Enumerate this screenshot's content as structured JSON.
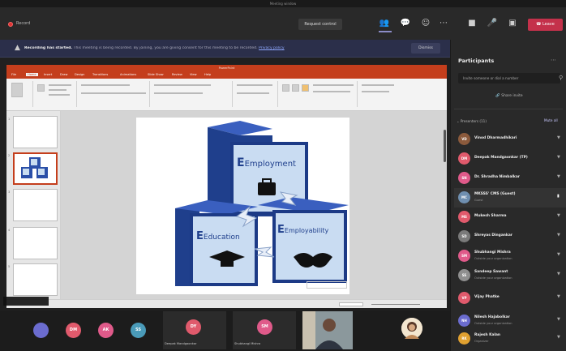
{
  "window": {
    "title": "Meeting window"
  },
  "toolbar": {
    "record_label": "Record",
    "request_control": "Request control",
    "leave_label": "Leave",
    "icons": [
      "people-icon",
      "chat-icon",
      "reactions-icon",
      "more-icon",
      "camera-icon",
      "mic-icon",
      "share-icon"
    ]
  },
  "banner": {
    "bold": "Recording has started.",
    "text": "This meeting is being recorded. By joining, you are giving consent for this meeting to be recorded.",
    "link": "Privacy policy",
    "dismiss": "Dismiss"
  },
  "ppt": {
    "title": "PowerPoint",
    "tabs": [
      "File",
      "Home",
      "Insert",
      "Draw",
      "Design",
      "Transitions",
      "Animations",
      "Slide Show",
      "Review",
      "View",
      "Help"
    ],
    "thumb_numbers": [
      "1",
      "2",
      "3",
      "4",
      "5"
    ]
  },
  "slide": {
    "blocks": {
      "top": "Employment",
      "left": "Education",
      "right": "Employability"
    },
    "caption": "",
    "footer_box": ""
  },
  "presenter_tag": "",
  "strip": {
    "avatars": [
      {
        "initials": "",
        "color": "#6b6ccf"
      },
      {
        "initials": "DM",
        "color": "#e05a6c"
      },
      {
        "initials": "AK",
        "color": "#e05a8a"
      },
      {
        "initials": "SS",
        "color": "#4a9bb9"
      }
    ],
    "tiles": [
      {
        "initials": "DY",
        "color": "#e05a6c",
        "label": "Deepak Mandgaonkar"
      },
      {
        "initials": "SM",
        "color": "#e05a8a",
        "label": "Shubhangi Mishra"
      }
    ]
  },
  "participants": {
    "title": "Participants",
    "search_placeholder": "Invite someone or dial a number",
    "share_invite": "Share invite",
    "section": "Presenters (11)",
    "mute_all": "Mute all",
    "list": [
      {
        "name": "Vinod Dharmadhikari",
        "sub": "",
        "initials": "VD",
        "color": "#8b5a3c"
      },
      {
        "name": "Deepak Mandgaonkar (TP)",
        "sub": "",
        "initials": "DM",
        "color": "#e05a6c"
      },
      {
        "name": "Dr. Shradha Nimbalkar",
        "sub": "",
        "initials": "SN",
        "color": "#e05a8a"
      },
      {
        "name": "MKSSS' CMS (Guest)",
        "sub": "Guest",
        "initials": "MC",
        "color": "#6f8fb0"
      },
      {
        "name": "Mukesh Sharma",
        "sub": "",
        "initials": "MS",
        "color": "#e05a6c"
      },
      {
        "name": "Shreyas Dingankar",
        "sub": "",
        "initials": "SD",
        "color": "#7a7a7a"
      },
      {
        "name": "Shubhangi Mishra",
        "sub": "Outside your organization",
        "initials": "SM",
        "color": "#e05a8a"
      },
      {
        "name": "Sandeep Sawant",
        "sub": "Outside your organization",
        "initials": "SS",
        "color": "#8f8f8f"
      },
      {
        "name": "Vijay Phatke",
        "sub": "",
        "initials": "VP",
        "color": "#e05a6c"
      },
      {
        "name": "Nilesh Hajabolkar",
        "sub": "Outside your organization",
        "initials": "NH",
        "color": "#6b6ccf"
      },
      {
        "name": "Rajesh Kalan",
        "sub": "Organizer",
        "initials": "RK",
        "color": "#e0a030"
      }
    ]
  }
}
